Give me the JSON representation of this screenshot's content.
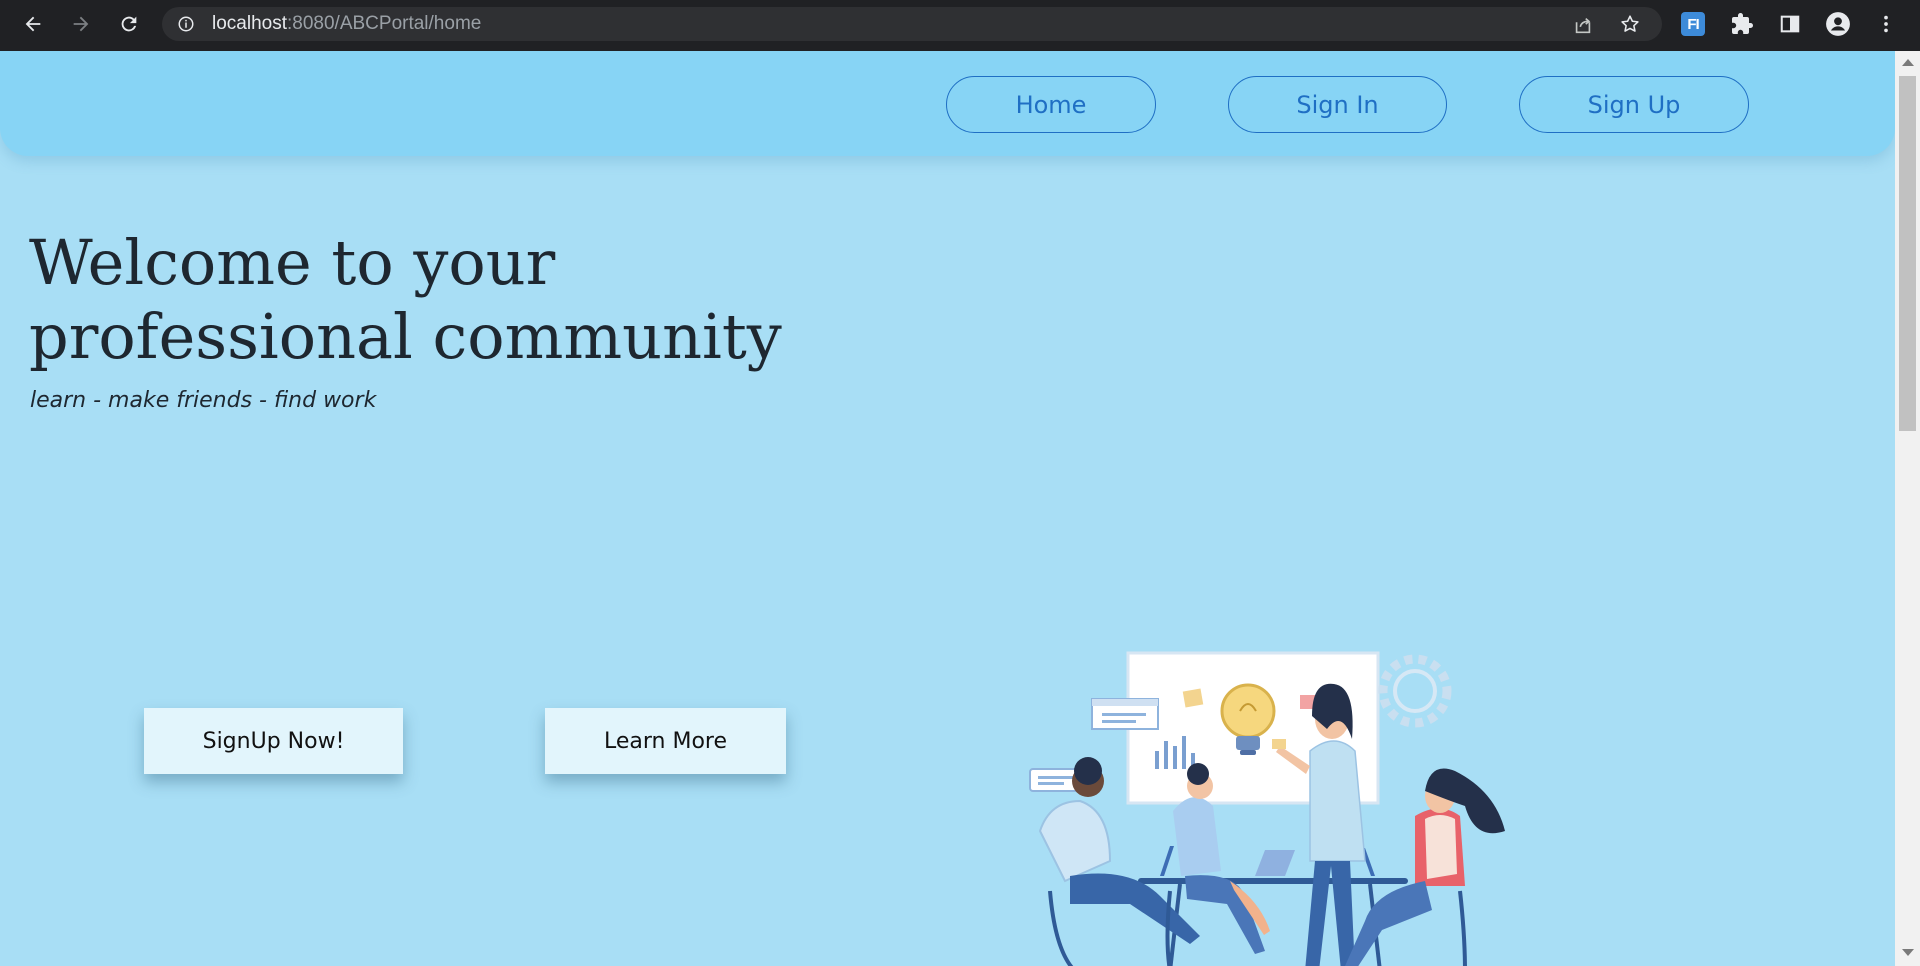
{
  "browser": {
    "url_host": "localhost",
    "url_rest": ":8080/ABCPortal/home",
    "extension_badge": "FI"
  },
  "nav": {
    "links": [
      {
        "label": "Home"
      },
      {
        "label": "Sign In"
      },
      {
        "label": "Sign Up"
      }
    ]
  },
  "hero": {
    "title": "Welcome to your professional community",
    "subtitle": "learn - make friends - find work",
    "primary_button": "SignUp Now!",
    "secondary_button": "Learn More"
  },
  "colors": {
    "page_background": "#a8def5",
    "nav_background": "#87d4f5",
    "nav_link": "#1f6fc4",
    "button_background": "#e2f5fc",
    "browser_chrome": "#202124"
  }
}
